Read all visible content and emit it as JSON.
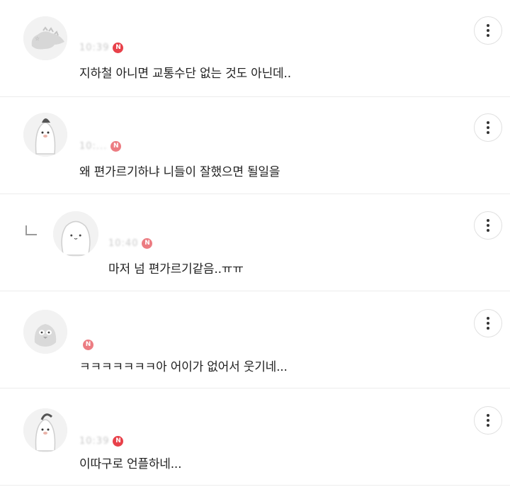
{
  "comments": [
    {
      "author": "",
      "time": "10:39",
      "badge": "N",
      "text": "지하철 아니면 교통수단 없는 것도 아닌데..",
      "is_reply": false
    },
    {
      "author": "",
      "time": "10:...",
      "badge": "N",
      "text": "왜 편가르기하냐 니들이 잘했으면 될일을",
      "is_reply": false
    },
    {
      "author": "",
      "time": "10:40",
      "badge": "N",
      "text": "마저 넘 편가르기같음..ㅠㅠ",
      "is_reply": true
    },
    {
      "author": "",
      "time": "",
      "badge": "N",
      "text": "ㅋㅋㅋㅋㅋㅋㅋ아 어이가 없어서 웃기네...",
      "is_reply": false
    },
    {
      "author": "",
      "time": "10:39",
      "badge": "N",
      "text": "이따구로 언플하네...",
      "is_reply": false
    }
  ],
  "more_icon": "more-vertical-icon",
  "colors": {
    "badge": "#e8414a",
    "divider": "#ececec",
    "text": "#1f1f1f"
  }
}
